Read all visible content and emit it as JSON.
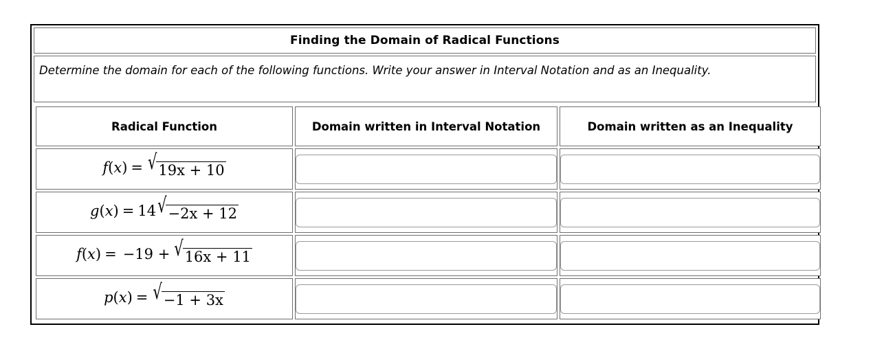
{
  "worksheet": {
    "title": "Finding the Domain of Radical Functions",
    "instructions": "Determine the domain for each of the following functions. Write your answer in Interval Notation and as an Inequality.",
    "columns": [
      "Radical Function",
      "Domain written in Interval Notation",
      "Domain written as an Inequality"
    ],
    "rows": [
      {
        "function_plain": "f(x) = √(19x + 10)",
        "name": "f",
        "var": "x",
        "leading": "",
        "coefficient": "",
        "radicand": "19x + 10",
        "interval_value": "",
        "interval_placeholder": "",
        "inequality_value": "",
        "inequality_placeholder": ""
      },
      {
        "function_plain": "g(x) = 14√(−2x + 12)",
        "name": "g",
        "var": "x",
        "leading": "",
        "coefficient": "14",
        "radicand": "−2x + 12",
        "interval_value": "",
        "interval_placeholder": "",
        "inequality_value": "",
        "inequality_placeholder": ""
      },
      {
        "function_plain": "f(x) = −19 + √(16x + 11)",
        "name": "f",
        "var": "x",
        "leading": "−19 +",
        "coefficient": "",
        "radicand": "16x + 11",
        "interval_value": "",
        "interval_placeholder": "",
        "inequality_value": "",
        "inequality_placeholder": ""
      },
      {
        "function_plain": "p(x) = √(−1 + 3x)",
        "name": "p",
        "var": "x",
        "leading": "",
        "coefficient": "",
        "radicand": "−1 + 3x",
        "interval_value": "",
        "interval_placeholder": "",
        "inequality_value": "",
        "inequality_placeholder": ""
      }
    ],
    "symbols": {
      "equals": "=",
      "radical": "√",
      "open_paren": "(",
      "close_paren": ")"
    },
    "colors": {
      "outer_border": "#000000",
      "cell_border": "#6e6e6e",
      "input_border": "#9a9a9a",
      "text": "#000000",
      "background": "#ffffff"
    }
  }
}
